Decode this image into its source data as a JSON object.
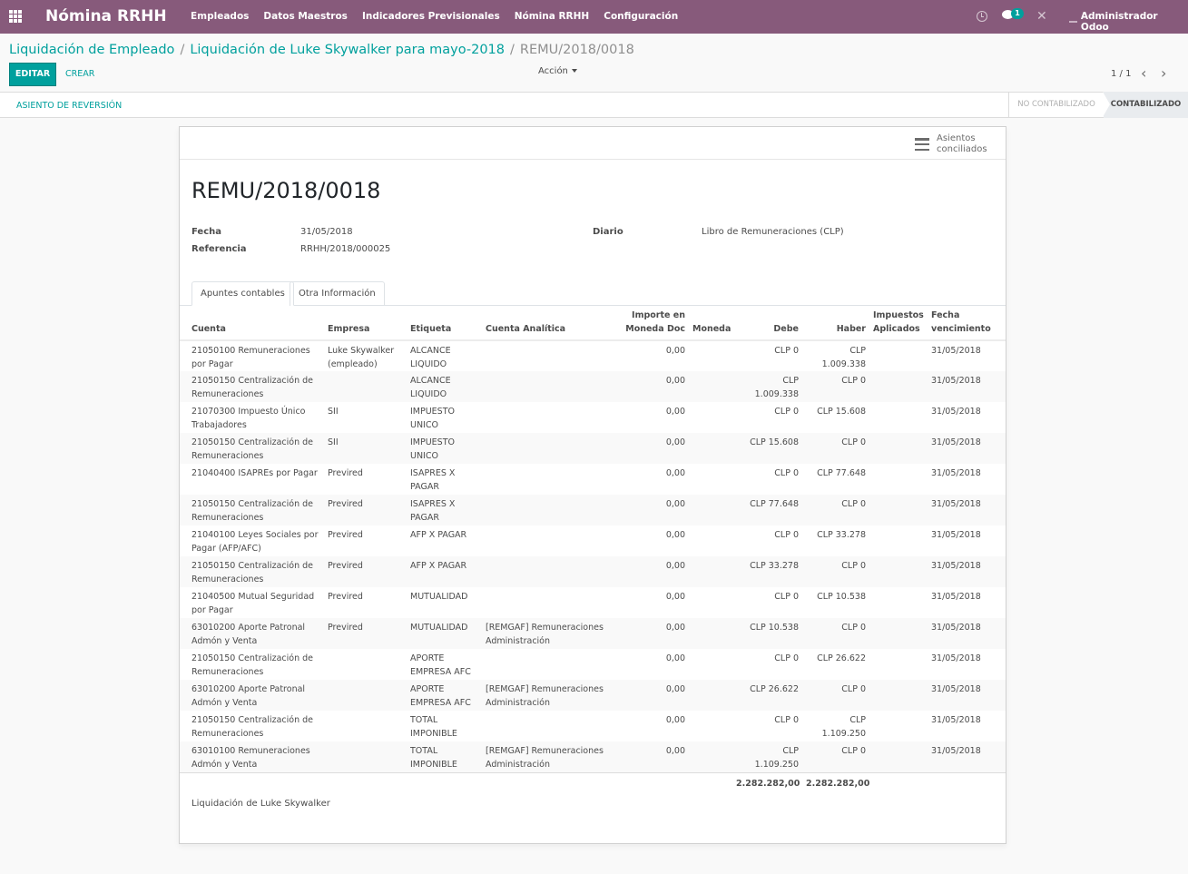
{
  "navbar": {
    "app_name": "Nómina RRHH",
    "menu": [
      "Empleados",
      "Datos Maestros",
      "Indicadores Previsionales",
      "Nómina RRHH",
      "Configuración"
    ],
    "chat_count": "1",
    "user": "Administrador Odoo"
  },
  "breadcrumb": {
    "items": [
      "Liquidación de Empleado",
      "Liquidación de Luke Skywalker para mayo-2018"
    ],
    "current": "REMU/2018/0018"
  },
  "controls": {
    "edit_label": "EDITAR",
    "create_label": "CREAR",
    "action_label": "Acción",
    "pager": "1 / 1"
  },
  "statusbar": {
    "reversal_label": "ASIENTO DE REVERSIÓN",
    "stages": [
      "NO CONTABILIZADO",
      "CONTABILIZADO"
    ],
    "active_stage": "CONTABILIZADO"
  },
  "form": {
    "stat_button": "Asientos conciliados",
    "title": "REMU/2018/0018",
    "fecha_label": "Fecha",
    "fecha_value": "31/05/2018",
    "referencia_label": "Referencia",
    "referencia_value": "RRHH/2018/000025",
    "diario_label": "Diario",
    "diario_value": "Libro de Remuneraciones (CLP)",
    "tabs": [
      "Apuntes contables",
      "Otra Información"
    ],
    "narration": "Liquidación de Luke Skywalker"
  },
  "table": {
    "headers": {
      "cuenta": "Cuenta",
      "empresa": "Empresa",
      "etiqueta": "Etiqueta",
      "analitica": "Cuenta Analítica",
      "importe": "Importe en Moneda Doc",
      "moneda": "Moneda",
      "debe": "Debe",
      "haber": "Haber",
      "impuestos": "Impuestos Aplicados",
      "vencimiento": "Fecha vencimiento"
    },
    "rows": [
      {
        "cuenta": "21050100 Remuneraciones por Pagar",
        "empresa": "Luke Skywalker (empleado)",
        "etiqueta": "ALCANCE LIQUIDO",
        "analitica": "",
        "importe": "0,00",
        "moneda": "",
        "debe": "CLP 0",
        "haber": "CLP 1.009.338",
        "impuestos": "",
        "vencimiento": "31/05/2018"
      },
      {
        "cuenta": "21050150 Centralización de Remuneraciones",
        "empresa": "",
        "etiqueta": "ALCANCE LIQUIDO",
        "analitica": "",
        "importe": "0,00",
        "moneda": "",
        "debe": "CLP 1.009.338",
        "haber": "CLP 0",
        "impuestos": "",
        "vencimiento": "31/05/2018"
      },
      {
        "cuenta": "21070300 Impuesto Único Trabajadores",
        "empresa": "SII",
        "etiqueta": "IMPUESTO UNICO",
        "analitica": "",
        "importe": "0,00",
        "moneda": "",
        "debe": "CLP 0",
        "haber": "CLP 15.608",
        "impuestos": "",
        "vencimiento": "31/05/2018"
      },
      {
        "cuenta": "21050150 Centralización de Remuneraciones",
        "empresa": "SII",
        "etiqueta": "IMPUESTO UNICO",
        "analitica": "",
        "importe": "0,00",
        "moneda": "",
        "debe": "CLP 15.608",
        "haber": "CLP 0",
        "impuestos": "",
        "vencimiento": "31/05/2018"
      },
      {
        "cuenta": "21040400 ISAPREs por Pagar",
        "empresa": "Previred",
        "etiqueta": "ISAPRES X PAGAR",
        "analitica": "",
        "importe": "0,00",
        "moneda": "",
        "debe": "CLP 0",
        "haber": "CLP 77.648",
        "impuestos": "",
        "vencimiento": "31/05/2018"
      },
      {
        "cuenta": "21050150 Centralización de Remuneraciones",
        "empresa": "Previred",
        "etiqueta": "ISAPRES X PAGAR",
        "analitica": "",
        "importe": "0,00",
        "moneda": "",
        "debe": "CLP 77.648",
        "haber": "CLP 0",
        "impuestos": "",
        "vencimiento": "31/05/2018"
      },
      {
        "cuenta": "21040100 Leyes Sociales por Pagar (AFP/AFC)",
        "empresa": "Previred",
        "etiqueta": "AFP X PAGAR",
        "analitica": "",
        "importe": "0,00",
        "moneda": "",
        "debe": "CLP 0",
        "haber": "CLP 33.278",
        "impuestos": "",
        "vencimiento": "31/05/2018"
      },
      {
        "cuenta": "21050150 Centralización de Remuneraciones",
        "empresa": "Previred",
        "etiqueta": "AFP X PAGAR",
        "analitica": "",
        "importe": "0,00",
        "moneda": "",
        "debe": "CLP 33.278",
        "haber": "CLP 0",
        "impuestos": "",
        "vencimiento": "31/05/2018"
      },
      {
        "cuenta": "21040500 Mutual Seguridad por Pagar",
        "empresa": "Previred",
        "etiqueta": "MUTUALIDAD",
        "analitica": "",
        "importe": "0,00",
        "moneda": "",
        "debe": "CLP 0",
        "haber": "CLP 10.538",
        "impuestos": "",
        "vencimiento": "31/05/2018"
      },
      {
        "cuenta": "63010200 Aporte Patronal Admón y Venta",
        "empresa": "Previred",
        "etiqueta": "MUTUALIDAD",
        "analitica": "[REMGAF] Remuneraciones Administración",
        "importe": "0,00",
        "moneda": "",
        "debe": "CLP 10.538",
        "haber": "CLP 0",
        "impuestos": "",
        "vencimiento": "31/05/2018"
      },
      {
        "cuenta": "21050150 Centralización de Remuneraciones",
        "empresa": "",
        "etiqueta": "APORTE EMPRESA AFC",
        "analitica": "",
        "importe": "0,00",
        "moneda": "",
        "debe": "CLP 0",
        "haber": "CLP 26.622",
        "impuestos": "",
        "vencimiento": "31/05/2018"
      },
      {
        "cuenta": "63010200 Aporte Patronal Admón y Venta",
        "empresa": "",
        "etiqueta": "APORTE EMPRESA AFC",
        "analitica": "[REMGAF] Remuneraciones Administración",
        "importe": "0,00",
        "moneda": "",
        "debe": "CLP 26.622",
        "haber": "CLP 0",
        "impuestos": "",
        "vencimiento": "31/05/2018"
      },
      {
        "cuenta": "21050150 Centralización de Remuneraciones",
        "empresa": "",
        "etiqueta": "TOTAL IMPONIBLE",
        "analitica": "",
        "importe": "0,00",
        "moneda": "",
        "debe": "CLP 0",
        "haber": "CLP 1.109.250",
        "impuestos": "",
        "vencimiento": "31/05/2018"
      },
      {
        "cuenta": "63010100 Remuneraciones Admón y Venta",
        "empresa": "",
        "etiqueta": "TOTAL IMPONIBLE",
        "analitica": "[REMGAF] Remuneraciones Administración",
        "importe": "0,00",
        "moneda": "",
        "debe": "CLP 1.109.250",
        "haber": "CLP 0",
        "impuestos": "",
        "vencimiento": "31/05/2018"
      }
    ],
    "total_debe": "2.282.282,00",
    "total_haber": "2.282.282,00"
  }
}
